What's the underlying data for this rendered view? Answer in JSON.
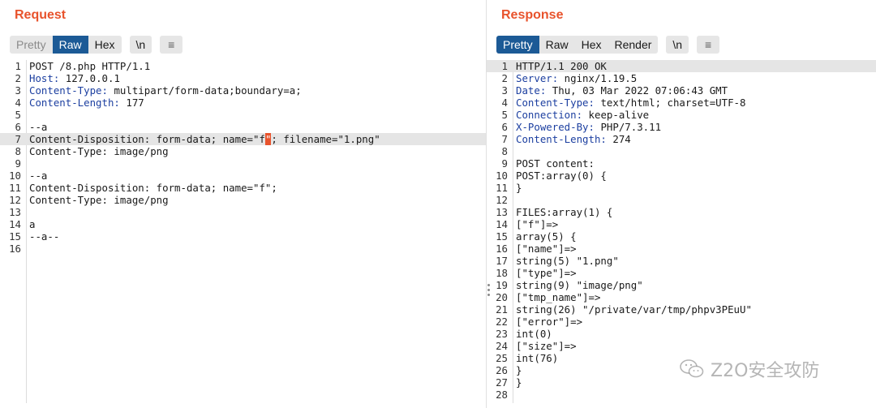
{
  "request": {
    "title": "Request",
    "tabs": [
      "Pretty",
      "Raw",
      "Hex"
    ],
    "newline_toggle": "\\n",
    "lines": [
      {
        "n": "1",
        "k": "",
        "v": "POST /8.php HTTP/1.1"
      },
      {
        "n": "2",
        "k": "Host:",
        "v": " 127.0.0.1"
      },
      {
        "n": "3",
        "k": "Content-Type:",
        "v": " multipart/form-data;boundary=a;"
      },
      {
        "n": "4",
        "k": "Content-Length:",
        "v": " 177"
      },
      {
        "n": "5",
        "k": "",
        "v": ""
      },
      {
        "n": "6",
        "k": "",
        "v": "--a"
      },
      {
        "n": "7",
        "k": "",
        "v": "Content-Disposition: form-data; name=\"f\"; filename=\"1.png\""
      },
      {
        "n": "8",
        "k": "",
        "v": "Content-Type: image/png"
      },
      {
        "n": "9",
        "k": "",
        "v": ""
      },
      {
        "n": "10",
        "k": "",
        "v": "--a"
      },
      {
        "n": "11",
        "k": "",
        "v": "Content-Disposition: form-data; name=\"f\";"
      },
      {
        "n": "12",
        "k": "",
        "v": "Content-Type: image/png"
      },
      {
        "n": "13",
        "k": "",
        "v": ""
      },
      {
        "n": "14",
        "k": "",
        "v": "a"
      },
      {
        "n": "15",
        "k": "",
        "v": "--a--"
      },
      {
        "n": "16",
        "k": "",
        "v": ""
      }
    ]
  },
  "response": {
    "title": "Response",
    "tabs": [
      "Pretty",
      "Raw",
      "Hex",
      "Render"
    ],
    "newline_toggle": "\\n",
    "lines": [
      {
        "n": "1",
        "k": "",
        "v": "HTTP/1.1 200 OK"
      },
      {
        "n": "2",
        "k": "Server:",
        "v": " nginx/1.19.5"
      },
      {
        "n": "3",
        "k": "Date:",
        "v": " Thu, 03 Mar 2022 07:06:43 GMT"
      },
      {
        "n": "4",
        "k": "Content-Type:",
        "v": " text/html; charset=UTF-8"
      },
      {
        "n": "5",
        "k": "Connection:",
        "v": " keep-alive"
      },
      {
        "n": "6",
        "k": "X-Powered-By:",
        "v": " PHP/7.3.11"
      },
      {
        "n": "7",
        "k": "Content-Length:",
        "v": " 274"
      },
      {
        "n": "8",
        "k": "",
        "v": ""
      },
      {
        "n": "9",
        "k": "",
        "v": "POST content:"
      },
      {
        "n": "10",
        "k": "",
        "v": "POST:array(0) {"
      },
      {
        "n": "11",
        "k": "",
        "v": "}"
      },
      {
        "n": "12",
        "k": "",
        "v": ""
      },
      {
        "n": "13",
        "k": "",
        "v": "FILES:array(1) {"
      },
      {
        "n": "14",
        "k": "",
        "v": "[\"f\"]=>"
      },
      {
        "n": "15",
        "k": "",
        "v": "array(5) {"
      },
      {
        "n": "16",
        "k": "",
        "v": "[\"name\"]=>"
      },
      {
        "n": "17",
        "k": "",
        "v": "string(5) \"1.png\""
      },
      {
        "n": "18",
        "k": "",
        "v": "[\"type\"]=>"
      },
      {
        "n": "19",
        "k": "",
        "v": "string(9) \"image/png\""
      },
      {
        "n": "20",
        "k": "",
        "v": "[\"tmp_name\"]=>"
      },
      {
        "n": "21",
        "k": "",
        "v": "string(26) \"/private/var/tmp/phpv3PEuU\""
      },
      {
        "n": "22",
        "k": "",
        "v": "[\"error\"]=>"
      },
      {
        "n": "23",
        "k": "",
        "v": "int(0)"
      },
      {
        "n": "24",
        "k": "",
        "v": "[\"size\"]=>"
      },
      {
        "n": "25",
        "k": "",
        "v": "int(76)"
      },
      {
        "n": "26",
        "k": "",
        "v": "}"
      },
      {
        "n": "27",
        "k": "",
        "v": "}"
      },
      {
        "n": "28",
        "k": "",
        "v": ""
      }
    ]
  },
  "watermark": {
    "icon": "wechat-icon",
    "text": "Z2O安全攻防"
  }
}
